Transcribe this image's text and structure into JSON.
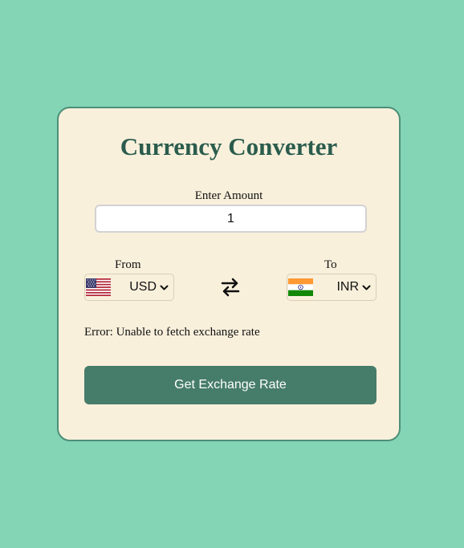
{
  "converter": {
    "title": "Currency Converter",
    "amount_label": "Enter Amount",
    "amount_value": "1",
    "from": {
      "label": "From",
      "currency": "USD",
      "flag_icon": "us-flag-icon"
    },
    "to": {
      "label": "To",
      "currency": "INR",
      "flag_icon": "india-flag-icon"
    },
    "swap_icon": "swap-arrows-icon",
    "message": "Error: Unable to fetch exchange rate",
    "button_label": "Get Exchange Rate"
  },
  "colors": {
    "page_background": "#84d4b6",
    "card_background": "#f9f0dc",
    "card_border": "#4d8f78",
    "title": "#2b5c4d",
    "button": "#467c6a",
    "button_text": "#ffffff"
  }
}
